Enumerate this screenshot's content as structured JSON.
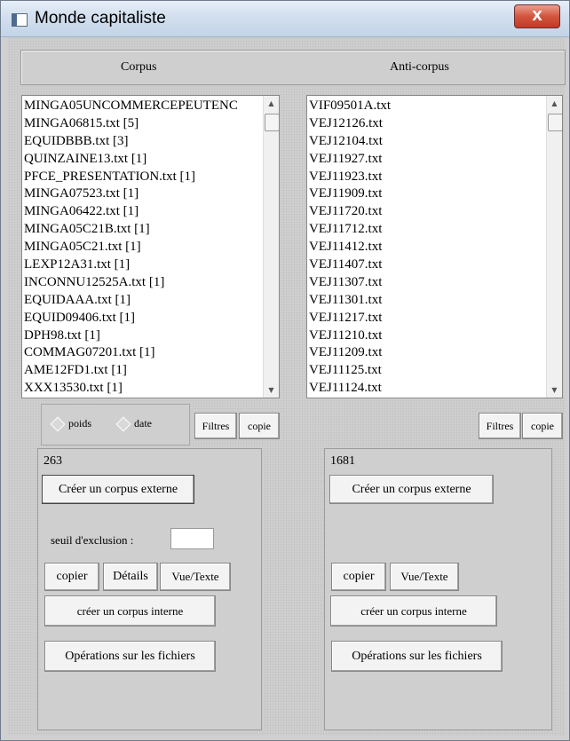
{
  "window": {
    "title": "Monde capitaliste",
    "close_glyph": "X"
  },
  "header": {
    "left": "Corpus",
    "right": "Anti-corpus"
  },
  "corpus_list": {
    "items": [
      "MINGA05UNCOMMERCEPEUTENC",
      "MINGA06815.txt [5]",
      "EQUIDBBB.txt [3]",
      "QUINZAINE13.txt [1]",
      "PFCE_PRESENTATION.txt [1]",
      "MINGA07523.txt [1]",
      "MINGA06422.txt [1]",
      "MINGA05C21B.txt [1]",
      "MINGA05C21.txt [1]",
      "LEXP12A31.txt [1]",
      "INCONNU12525A.txt [1]",
      "EQUIDAAA.txt [1]",
      "EQUID09406.txt [1]",
      "DPH98.txt [1]",
      "COMMAG07201.txt [1]",
      "AME12FD1.txt [1]",
      "XXX13530.txt [1]"
    ]
  },
  "anticorpus_list": {
    "items": [
      "VIF09501A.txt",
      "VEJ12126.txt",
      "VEJ12104.txt",
      "VEJ11927.txt",
      "VEJ11923.txt",
      "VEJ11909.txt",
      "VEJ11720.txt",
      "VEJ11712.txt",
      "VEJ11412.txt",
      "VEJ11407.txt",
      "VEJ11307.txt",
      "VEJ11301.txt",
      "VEJ11217.txt",
      "VEJ11210.txt",
      "VEJ11209.txt",
      "VEJ11125.txt",
      "VEJ11124.txt"
    ]
  },
  "sort": {
    "poids": "poids",
    "date": "date"
  },
  "left_toolbar": {
    "filtres": "Filtres",
    "copie": "copie"
  },
  "right_toolbar": {
    "filtres": "Filtres",
    "copie": "copie"
  },
  "left_panel": {
    "count": "263",
    "create_external": "Créer un corpus externe",
    "threshold_label": "seuil d'exclusion :",
    "threshold_value": "",
    "copier": "copier",
    "details": "Détails",
    "vue_texte": "Vue/Texte",
    "create_internal": "créer un corpus interne",
    "file_ops": "Opérations sur les fichiers"
  },
  "right_panel": {
    "count": "1681",
    "create_external": "Créer un corpus externe",
    "copier": "copier",
    "vue_texte": "Vue/Texte",
    "create_internal": "créer un corpus interne",
    "file_ops": "Opérations sur les fichiers"
  },
  "icons": {
    "app": "window-app-icon",
    "up": "scroll-up-arrow-icon",
    "down": "scroll-down-arrow-icon"
  }
}
